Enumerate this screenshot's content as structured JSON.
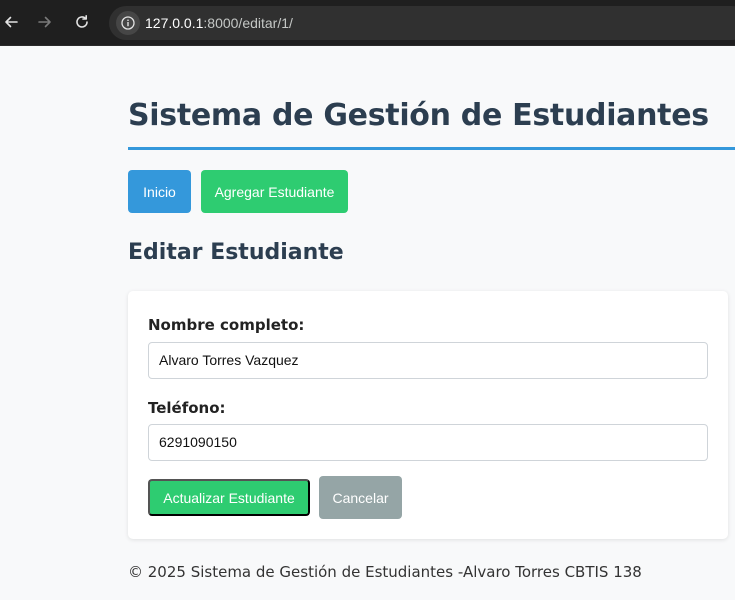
{
  "browser": {
    "url_host": "127.0.0.1",
    "url_path": ":8000/editar/1/",
    "back_icon": "arrow-left",
    "forward_icon": "arrow-right",
    "reload_icon": "reload",
    "site_info_icon": "info-circle"
  },
  "header": {
    "title": "Sistema de Gestión de Estudiantes"
  },
  "nav": {
    "home_label": "Inicio",
    "add_label": "Agregar Estudiante"
  },
  "section": {
    "title": "Editar Estudiante"
  },
  "form": {
    "name_label": "Nombre completo:",
    "name_value": "Alvaro Torres Vazquez",
    "phone_label": "Teléfono:",
    "phone_value": "6291090150",
    "submit_label": "Actualizar Estudiante",
    "cancel_label": "Cancelar"
  },
  "footer": {
    "text": "© 2025 Sistema de Gestión de Estudiantes -Alvaro Torres CBTIS 138"
  },
  "colors": {
    "primary": "#3498db",
    "success": "#2ecc71",
    "secondary": "#95a5a6",
    "heading": "#2c3e50"
  }
}
